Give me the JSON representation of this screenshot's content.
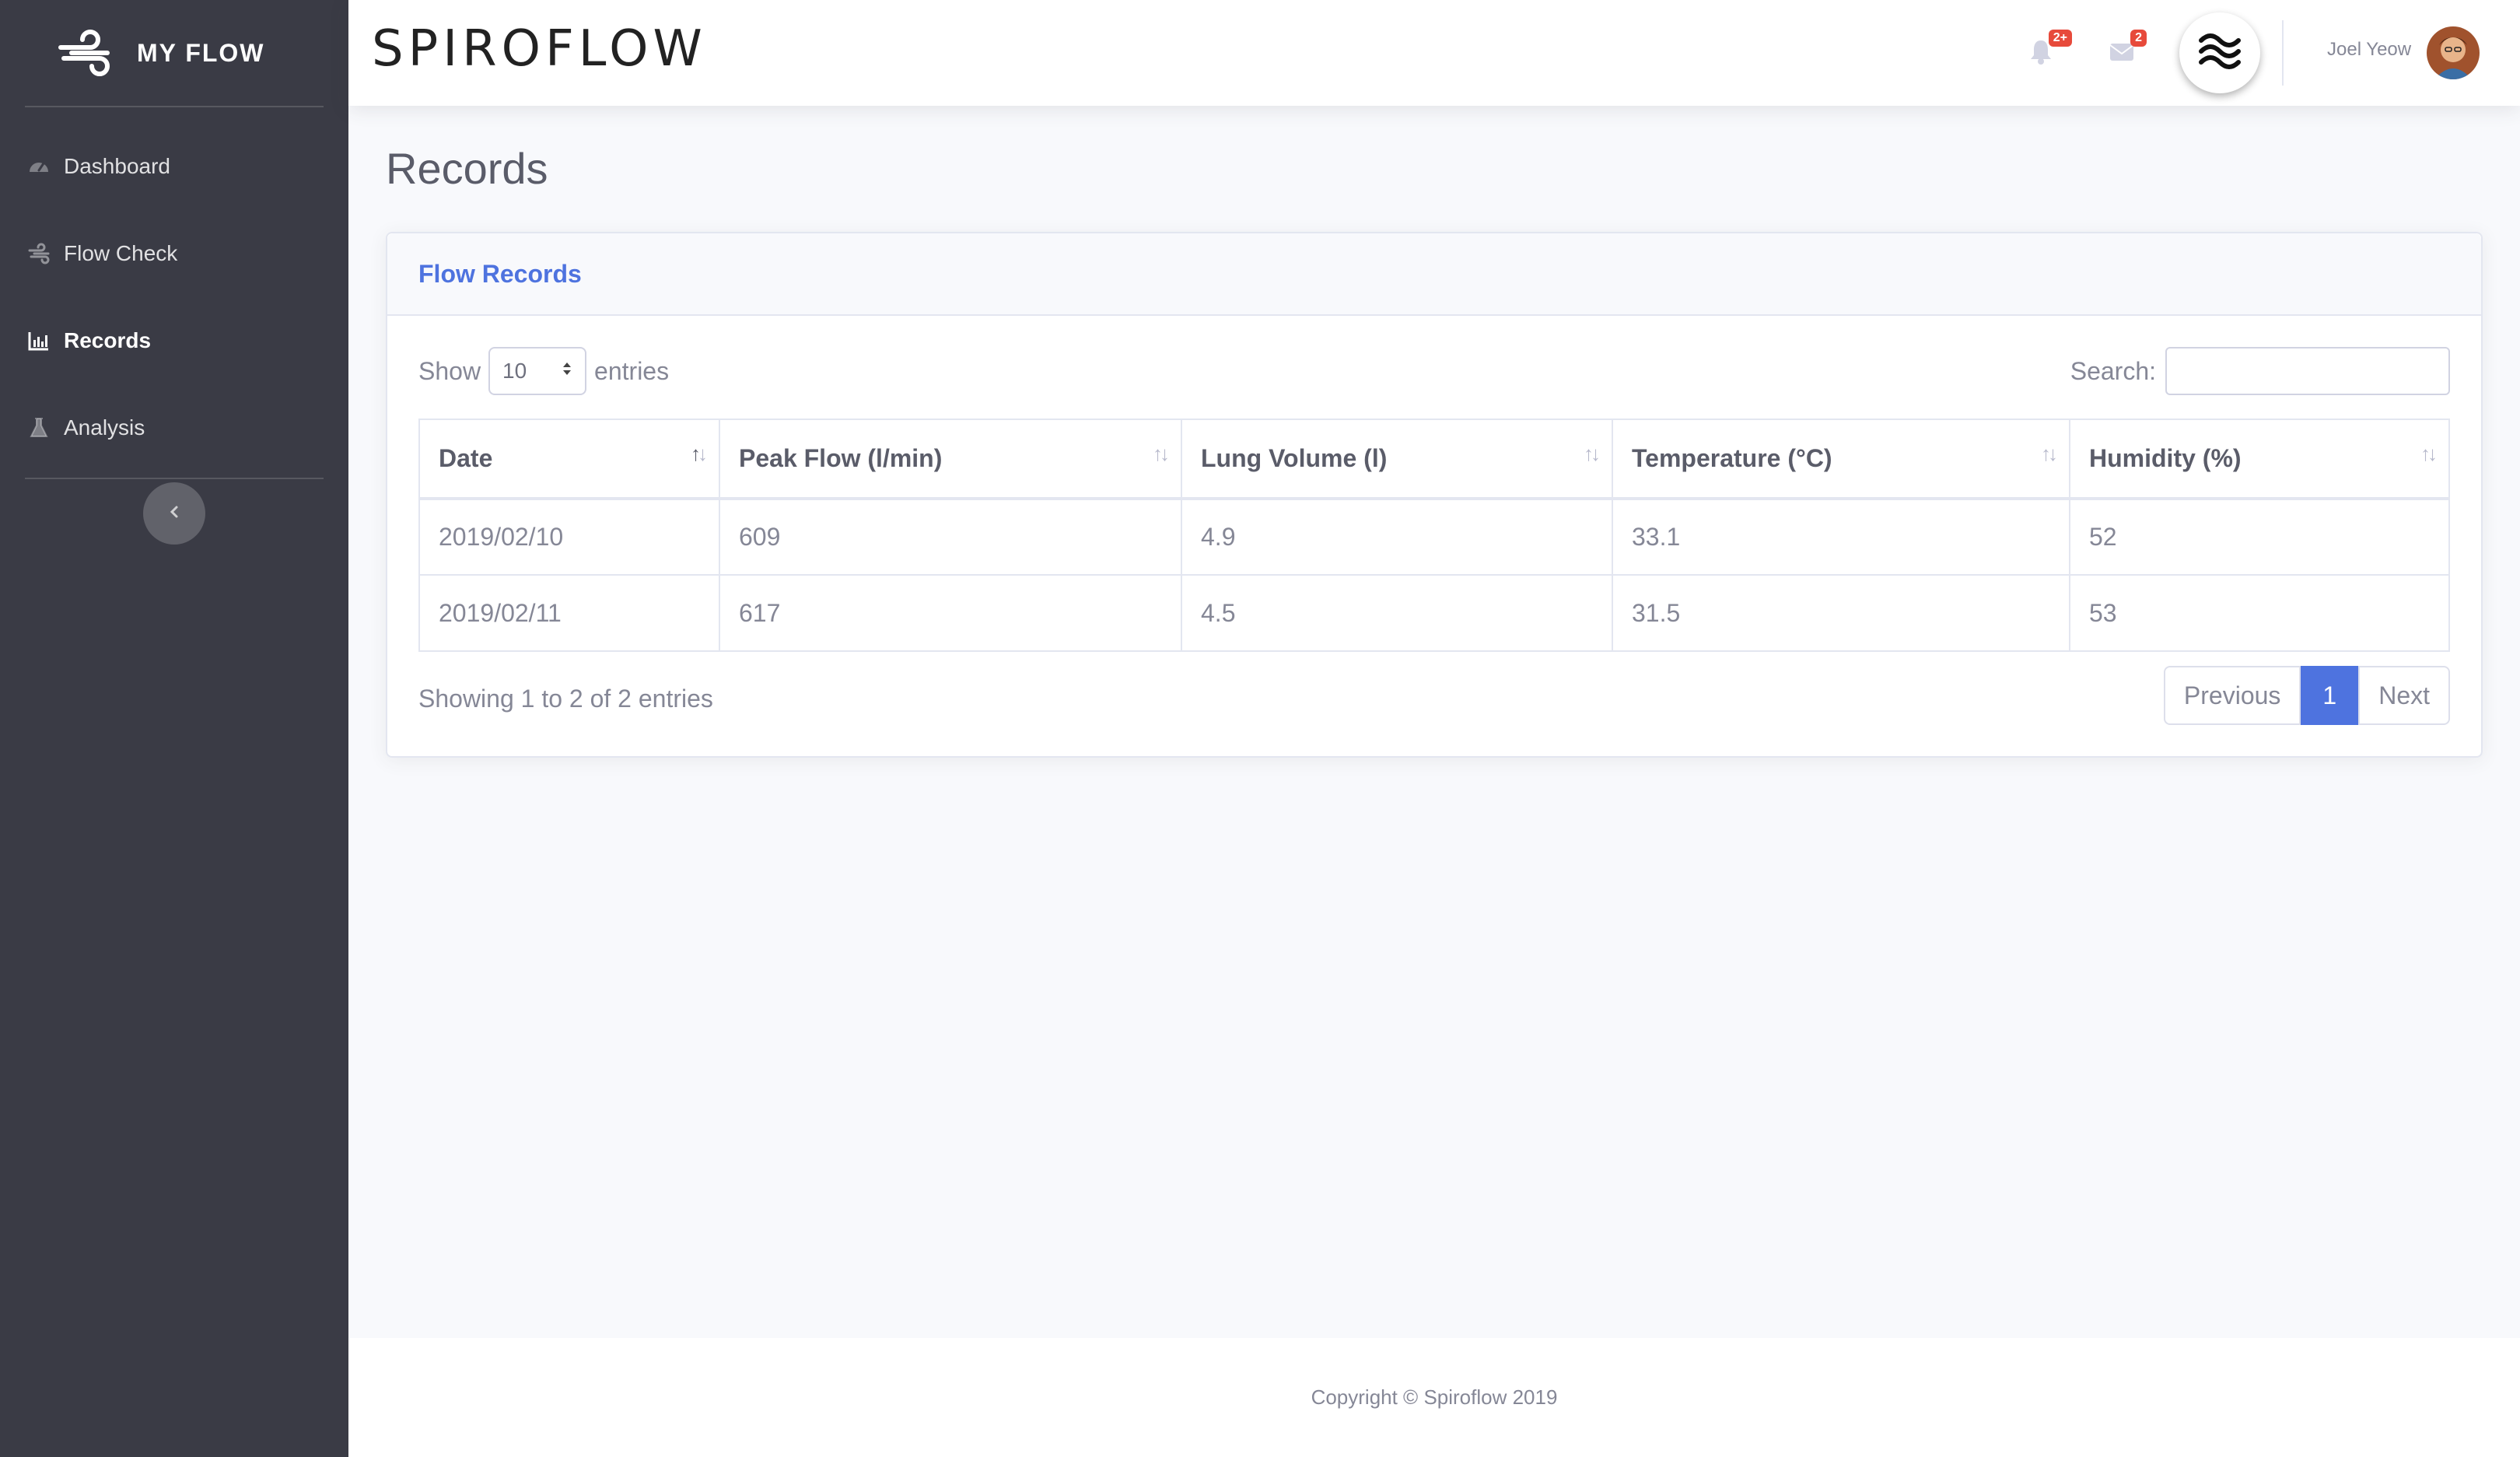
{
  "sidebar": {
    "brand": "MY FLOW",
    "brand_icon": "wind-icon",
    "items": [
      {
        "label": "Dashboard",
        "icon": "tachometer-icon",
        "active": false
      },
      {
        "label": "Flow Check",
        "icon": "wind-icon",
        "active": false
      },
      {
        "label": "Records",
        "icon": "bar-chart-icon",
        "active": true
      },
      {
        "label": "Analysis",
        "icon": "flask-icon",
        "active": false
      }
    ],
    "toggle_icon": "chevron-left-icon"
  },
  "topbar": {
    "app_title": "SPIROFLOW",
    "alerts_badge": "2+",
    "messages_badge": "2",
    "user_name": "Joel Yeow"
  },
  "page": {
    "title": "Records"
  },
  "card": {
    "title": "Flow Records",
    "show_label": "Show",
    "entries_value": "10",
    "entries_label": "entries",
    "search_label": "Search:",
    "search_value": ""
  },
  "table": {
    "columns": [
      "Date",
      "Peak Flow (l/min)",
      "Lung Volume (l)",
      "Temperature (°C)",
      "Humidity (%)"
    ],
    "rows": [
      [
        "2019/02/10",
        "609",
        "4.9",
        "33.1",
        "52"
      ],
      [
        "2019/02/11",
        "617",
        "4.5",
        "31.5",
        "53"
      ]
    ]
  },
  "footer_info": {
    "showing": "Showing 1 to 2 of 2 entries"
  },
  "pagination": {
    "previous": "Previous",
    "current": "1",
    "next": "Next"
  },
  "footer": {
    "copyright": "Copyright © Spiroflow 2019"
  },
  "colors": {
    "sidebar": "#3a3b45",
    "primary": "#4e73df",
    "badge": "#e74a3b"
  }
}
